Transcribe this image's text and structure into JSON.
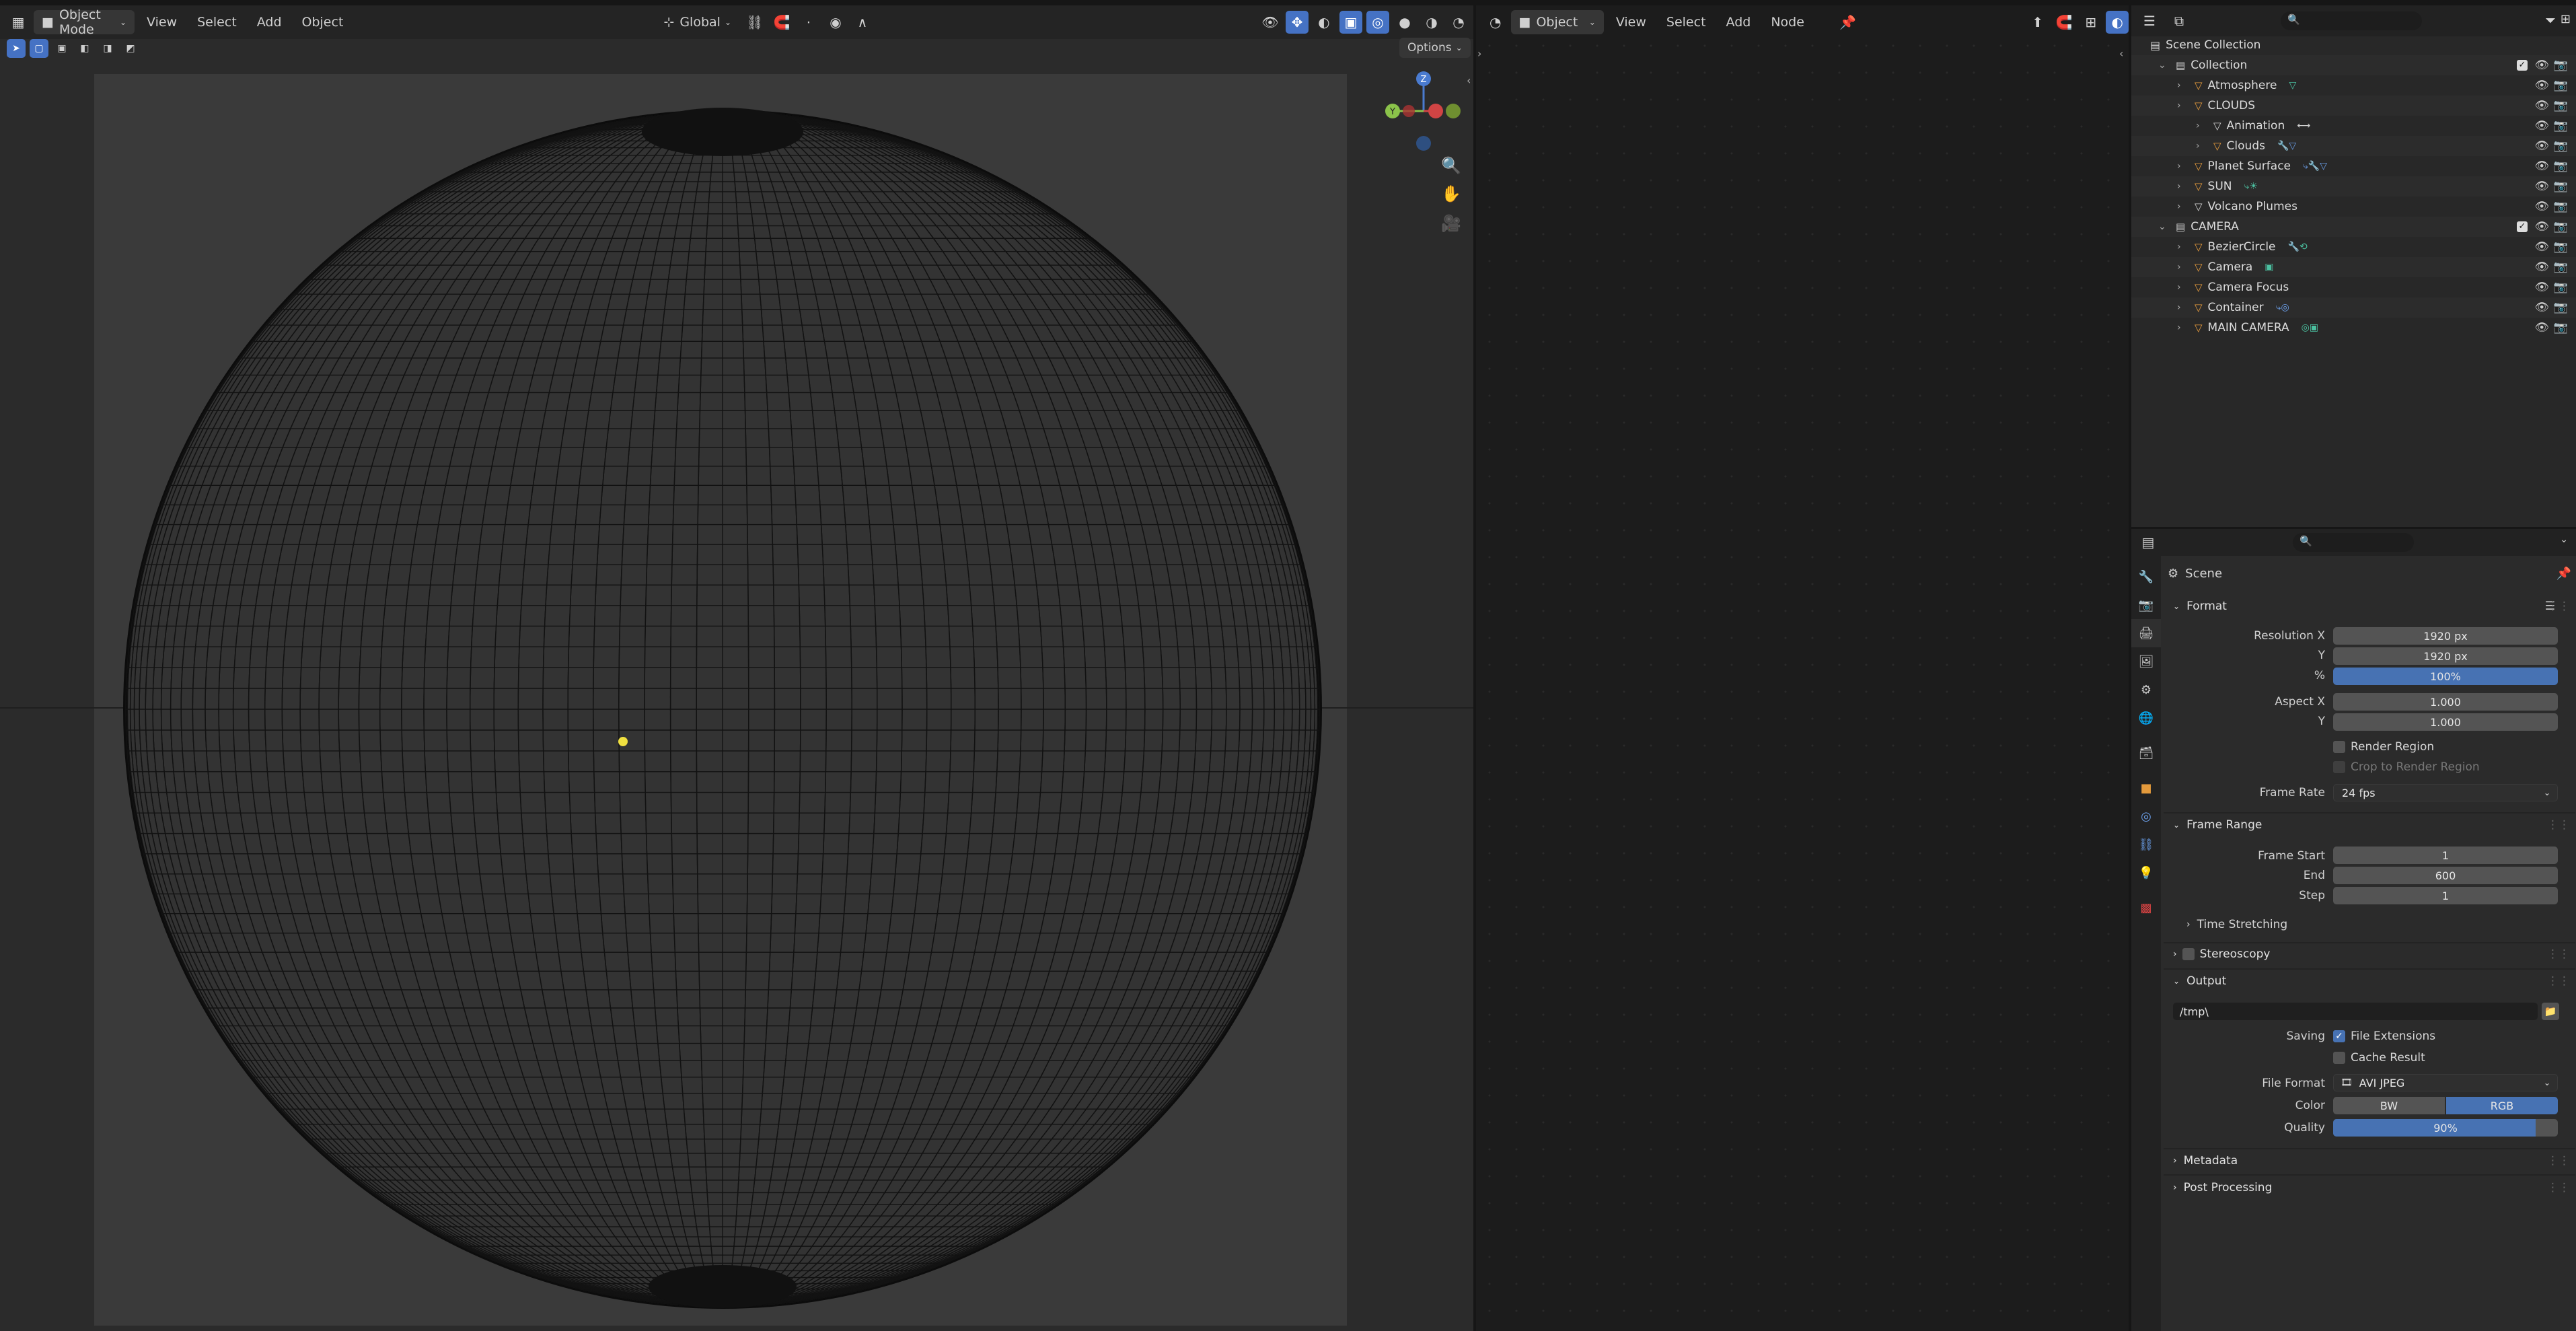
{
  "viewport_header": {
    "mode": "Object Mode",
    "menus": [
      "View",
      "Select",
      "Add",
      "Object"
    ],
    "transform_orientation": "Global",
    "options_label": "Options"
  },
  "gizmo": {
    "z": "Z",
    "y": "Y",
    "x": "X"
  },
  "node_header": {
    "type": "Object",
    "menus": [
      "View",
      "Select",
      "Add",
      "Node"
    ]
  },
  "outliner": {
    "root": "Scene Collection",
    "rows": [
      {
        "label": "Collection",
        "indent": 0,
        "icon_color": "#cfcfcf",
        "checkbox": true
      },
      {
        "label": "Atmosphere",
        "indent": 1,
        "icon_color": "#e49a3c",
        "extra": "▽",
        "extra_color": "#4bc0a0"
      },
      {
        "label": "CLOUDS",
        "indent": 1,
        "icon_color": "#e49a3c",
        "extra": ""
      },
      {
        "label": "Animation",
        "indent": 2,
        "icon_color": "#cfcfcf",
        "extra": "⟷",
        "extra_color": "#cfcfcf"
      },
      {
        "label": "Clouds",
        "indent": 2,
        "icon_color": "#e49a3c",
        "extra": "🔧▽",
        "extra_color": "#6a9ee8"
      },
      {
        "label": "Planet Surface",
        "indent": 1,
        "icon_color": "#e49a3c",
        "extra": "⤷🔧▽",
        "extra_color": "#6a9ee8"
      },
      {
        "label": "SUN",
        "indent": 1,
        "icon_color": "#e49a3c",
        "extra": "⤷☀",
        "extra_color": "#4bc0a0"
      },
      {
        "label": "Volcano Plumes",
        "indent": 1,
        "icon_color": "#cfcfcf",
        "extra": ""
      },
      {
        "label": "CAMERA",
        "indent": 0,
        "icon_color": "#cfcfcf",
        "checkbox": true
      },
      {
        "label": "BezierCircle",
        "indent": 1,
        "icon_color": "#e49a3c",
        "extra": "🔧⟲",
        "extra_color": "#4bc0a0"
      },
      {
        "label": "Camera",
        "indent": 1,
        "icon_color": "#e49a3c",
        "extra": "▣",
        "extra_color": "#4bc0a0"
      },
      {
        "label": "Camera Focus",
        "indent": 1,
        "icon_color": "#e49a3c",
        "extra": ""
      },
      {
        "label": "Container",
        "indent": 1,
        "icon_color": "#e49a3c",
        "extra": "⤷◎",
        "extra_color": "#6a9ee8"
      },
      {
        "label": "MAIN CAMERA",
        "indent": 1,
        "icon_color": "#e49a3c",
        "extra": "◎▣",
        "extra_color": "#4bc0a0"
      }
    ]
  },
  "properties": {
    "context": "Scene",
    "format": {
      "title": "Format",
      "resolution_x_label": "Resolution X",
      "resolution_x": "1920 px",
      "y_label": "Y",
      "resolution_y": "1920 px",
      "pct_label": "%",
      "percentage": "100%",
      "aspect_x_label": "Aspect X",
      "aspect_x": "1.000",
      "aspect_y_label": "Y",
      "aspect_y": "1.000",
      "render_region": "Render Region",
      "crop": "Crop to Render Region",
      "frame_rate_label": "Frame Rate",
      "frame_rate": "24 fps"
    },
    "frame_range": {
      "title": "Frame Range",
      "start_label": "Frame Start",
      "start": "1",
      "end_label": "End",
      "end": "600",
      "step_label": "Step",
      "step": "1",
      "time_stretching": "Time Stretching"
    },
    "stereoscopy": "Stereoscopy",
    "output": {
      "title": "Output",
      "path": "/tmp\\",
      "saving_label": "Saving",
      "file_extensions": "File Extensions",
      "cache_result": "Cache Result",
      "file_format_label": "File Format",
      "file_format": "AVI JPEG",
      "color_label": "Color",
      "color_bw": "BW",
      "color_rgb": "RGB",
      "quality_label": "Quality",
      "quality": "90%",
      "quality_value": 0.9
    },
    "metadata": "Metadata",
    "post_processing": "Post Processing"
  },
  "colors": {
    "accent": "#4772b3",
    "object_orange": "#e49a3c",
    "light_point": "#f0e040"
  }
}
